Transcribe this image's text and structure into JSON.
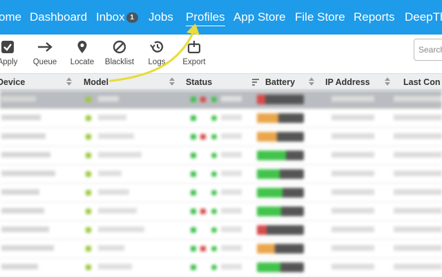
{
  "nav": {
    "items": [
      {
        "label": "ome",
        "name": "nav-home"
      },
      {
        "label": "Dashboard",
        "name": "nav-dashboard"
      },
      {
        "label": "Inbox",
        "name": "nav-inbox",
        "badge": "1"
      },
      {
        "label": "Jobs",
        "name": "nav-jobs"
      },
      {
        "label": "Profiles",
        "name": "nav-profiles",
        "active": true
      },
      {
        "label": "App Store",
        "name": "nav-app-store"
      },
      {
        "label": "File Store",
        "name": "nav-file-store"
      },
      {
        "label": "Reports",
        "name": "nav-reports"
      },
      {
        "label": "DeepTh",
        "name": "nav-deepthought"
      }
    ],
    "color": "#1e9be9"
  },
  "toolbar": {
    "apply": "Apply",
    "queue": "Queue",
    "locate": "Locate",
    "blacklist": "Blacklist",
    "logs": "Logs",
    "export": "Export"
  },
  "search": {
    "placeholder": "Search"
  },
  "table": {
    "columns": {
      "device": "Device",
      "model": "Model",
      "status": "Status",
      "battery": "Battery",
      "ip": "IP Address",
      "last": "Last Con"
    },
    "rows_blurred": true,
    "selected_row": 0
  },
  "annotation": {
    "arrow_color": "#e9dc3c",
    "points_to": "Profiles"
  }
}
